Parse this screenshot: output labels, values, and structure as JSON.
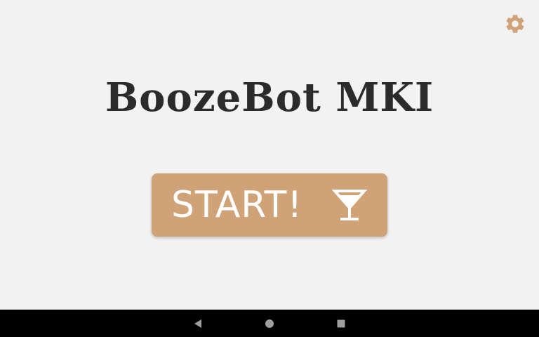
{
  "app": {
    "title": "BoozeBot MKI",
    "start_label": "START!"
  },
  "icons": {
    "settings": "gear-icon",
    "start": "cocktail-glass-icon",
    "nav_back": "back-triangle-icon",
    "nav_home": "home-circle-icon",
    "nav_recents": "recents-square-icon"
  },
  "colors": {
    "background": "#f2f2f2",
    "accent": "#cfa278",
    "title_text": "#2b2b2b",
    "button_text": "#ffffff",
    "navbar": "#000000",
    "nav_icons": "#9e9e9e"
  }
}
